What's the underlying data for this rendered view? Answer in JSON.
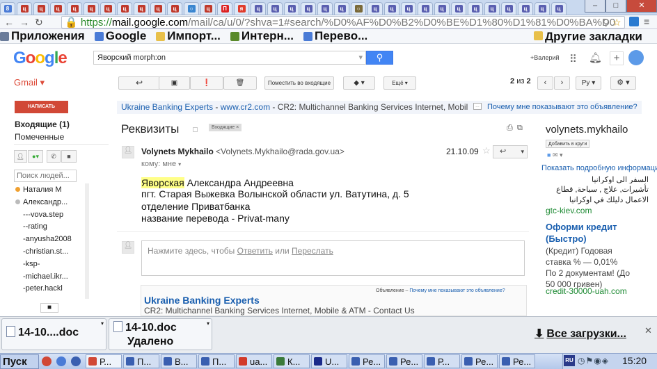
{
  "browser": {
    "tabs": [
      {
        "letter": "8",
        "color": "#4a7bd6"
      },
      {
        "letter": "ц",
        "color": "#c0392b"
      },
      {
        "letter": "ц",
        "color": "#c0392b"
      },
      {
        "letter": "ц",
        "color": "#c0392b"
      },
      {
        "letter": "ц",
        "color": "#c0392b"
      },
      {
        "letter": "ц",
        "color": "#c0392b"
      },
      {
        "letter": "ц",
        "color": "#c0392b"
      },
      {
        "letter": "ц",
        "color": "#c0392b"
      },
      {
        "letter": "ц",
        "color": "#c0392b"
      },
      {
        "letter": "ц",
        "color": "#c0392b"
      },
      {
        "letter": "ц",
        "color": "#c0392b"
      },
      {
        "letter": "○",
        "color": "#3a86d0"
      },
      {
        "letter": "ц",
        "color": "#c0392b"
      },
      {
        "letter": "П",
        "color": "#d22"
      },
      {
        "letter": "я",
        "color": "#e03c2c"
      },
      {
        "letter": "ц",
        "color": "#5a5fb0"
      },
      {
        "letter": "ц",
        "color": "#5a5fb0"
      },
      {
        "letter": "ц",
        "color": "#5a5fb0"
      },
      {
        "letter": "ц",
        "color": "#5a5fb0"
      },
      {
        "letter": "ц",
        "color": "#5a5fb0"
      },
      {
        "letter": "ц",
        "color": "#5a5fb0"
      },
      {
        "letter": "○",
        "color": "#7a6a3a"
      },
      {
        "letter": "ц",
        "color": "#5a5fb0"
      },
      {
        "letter": "ц",
        "color": "#5a5fb0"
      },
      {
        "letter": "ц",
        "color": "#5a5fb0"
      },
      {
        "letter": "ц",
        "color": "#5a5fb0"
      },
      {
        "letter": "ц",
        "color": "#5a5fb0"
      },
      {
        "letter": "ц",
        "color": "#5a5fb0"
      },
      {
        "letter": "ц",
        "color": "#5a5fb0"
      },
      {
        "letter": "ц",
        "color": "#5a5fb0"
      },
      {
        "letter": "ц",
        "color": "#5a5fb0"
      },
      {
        "letter": "ц",
        "color": "#5a5fb0"
      },
      {
        "letter": "ц",
        "color": "#5a5fb0"
      },
      {
        "letter": "ц",
        "color": "#5a5fb0"
      }
    ],
    "url_scheme": "https://",
    "url_host": "mail.google.com",
    "url_path": "/mail/ca/u/0/?shva=1#search/%D0%AF%D0%B2%D0%BE%D1%80%D1%81%D0%BA%D0",
    "bookmarks": [
      {
        "label": "Приложения",
        "icon": "apps-icon",
        "color": "#6a7c9a"
      },
      {
        "label": "Google",
        "icon": "google-icon",
        "color": "#4a7bd6"
      },
      {
        "label": "Импорт...",
        "icon": "folder-icon",
        "color": "#e8c04a"
      },
      {
        "label": "Интерн...",
        "icon": "leaf-icon",
        "color": "#5a8a2a"
      },
      {
        "label": "Перево...",
        "icon": "translate-icon",
        "color": "#4a7bd6"
      }
    ],
    "other_bookmarks": "Другие закладки"
  },
  "header": {
    "logo_letters": [
      {
        "ch": "G",
        "color": "#4285f4"
      },
      {
        "ch": "o",
        "color": "#ea4335"
      },
      {
        "ch": "o",
        "color": "#fbbc05"
      },
      {
        "ch": "g",
        "color": "#4285f4"
      },
      {
        "ch": "l",
        "color": "#34a853"
      },
      {
        "ch": "e",
        "color": "#ea4335"
      }
    ],
    "search_value": "Яворский morph:on",
    "user_link": "+Валерий"
  },
  "toolbar": {
    "gmail_label": "Gmail ▾",
    "move_to_inbox": "Поместить во входящие",
    "more": "Ещё ▾",
    "pager_current": "2",
    "pager_of": "из",
    "pager_total": "2",
    "lang": "Ру"
  },
  "sidebar": {
    "compose": "НАПИСАТЬ",
    "inbox": "Входящие (1)",
    "starred": "Помеченные",
    "people_search_placeholder": "Поиск людей...",
    "contacts": [
      {
        "label": "Наталия М",
        "dot": "#f0a030"
      },
      {
        "label": "Александр...",
        "dot": "#bbbbbb"
      },
      {
        "label": "---vova.step",
        "dot": ""
      },
      {
        "label": "--rating",
        "dot": ""
      },
      {
        "label": "-anyusha2008",
        "dot": ""
      },
      {
        "label": "-christian.st...",
        "dot": ""
      },
      {
        "label": "-ksp-",
        "dot": ""
      },
      {
        "label": "-michael.ikr...",
        "dot": ""
      },
      {
        "label": "-peter.hackl",
        "dot": ""
      }
    ]
  },
  "adbar": {
    "title": "Ukraine Banking Experts",
    "url": "www.cr2.com",
    "desc": "CR2: Multichannel Banking Services Internet, Mobil",
    "why": "Почему мне показывают это объявление?"
  },
  "message": {
    "subject": "Реквизиты",
    "label_chip": "Входящие ×",
    "sender_name": "Volynets Mykhailo",
    "sender_email": "<Volynets.Mykhailo@rada.gov.ua>",
    "date": "21.10.09",
    "to": "кому: мне",
    "body_highlight": "Яворская",
    "body_line1_rest": " Александра Андреевна",
    "body_line2": "пгт. Старая Выжевка Волынской области ул. Ватутина, д. 5",
    "body_line3": "отделение Приватбанка",
    "body_line4": "название перевода - Privat-many",
    "reply_prompt": "Нажмите здесь, чтобы ",
    "reply_link": "Ответить",
    "reply_or": " или ",
    "forward_link": "Переслать"
  },
  "ad2": {
    "meta_label": "Объявление –",
    "meta_why": "Почему мне показывают это объявление?",
    "title": "Ukraine Banking Experts",
    "desc": "CR2: Multichannel Banking Services Internet, Mobile & ATM - Contact Us"
  },
  "right_panel": {
    "name": "volynets.mykhailo",
    "add_circles": "Добавить в круги",
    "more_info": "Показать подробную информаци",
    "ar_line1": "السفر الى اوكرانيا",
    "ar_line2": "تأشيرات, علاج , سياحة, قطاع",
    "ar_line3": "الاعمال دليلك في اوكرانيا",
    "ar_url": "gtc-kiev.com",
    "credit_title": "Оформи кредит (Быстро)",
    "credit_body1": "(Кредит) Годовая",
    "credit_body2": "ставка % — 0,01%",
    "credit_body3": "По 2 документам! (До",
    "credit_body4": "50 000 гривен)",
    "credit_url": "credit-30000-uah.com"
  },
  "downloads": {
    "item1": "14-10....doc",
    "item2_name": "14-10.doc",
    "item2_status": "Удалено",
    "all": "Все загрузки..."
  },
  "taskbar": {
    "start": "Пуск",
    "items": [
      {
        "label": "Р...",
        "color": "#d14836"
      },
      {
        "label": "П...",
        "color": "#3a5fb0"
      },
      {
        "label": "В...",
        "color": "#3a5fb0"
      },
      {
        "label": "П...",
        "color": "#3a5fb0"
      },
      {
        "label": "ua...",
        "color": "#d23a2a"
      },
      {
        "label": "К...",
        "color": "#3a7a3a"
      },
      {
        "label": "U...",
        "color": "#1a2a8a"
      },
      {
        "label": "Ре...",
        "color": "#3a5fb0"
      },
      {
        "label": "Ре...",
        "color": "#3a5fb0"
      },
      {
        "label": "Р...",
        "color": "#3a5fb0"
      },
      {
        "label": "Ре...",
        "color": "#3a5fb0"
      },
      {
        "label": "Ре...",
        "color": "#3a5fb0"
      }
    ],
    "lang": "RU",
    "clock": "15:20"
  }
}
